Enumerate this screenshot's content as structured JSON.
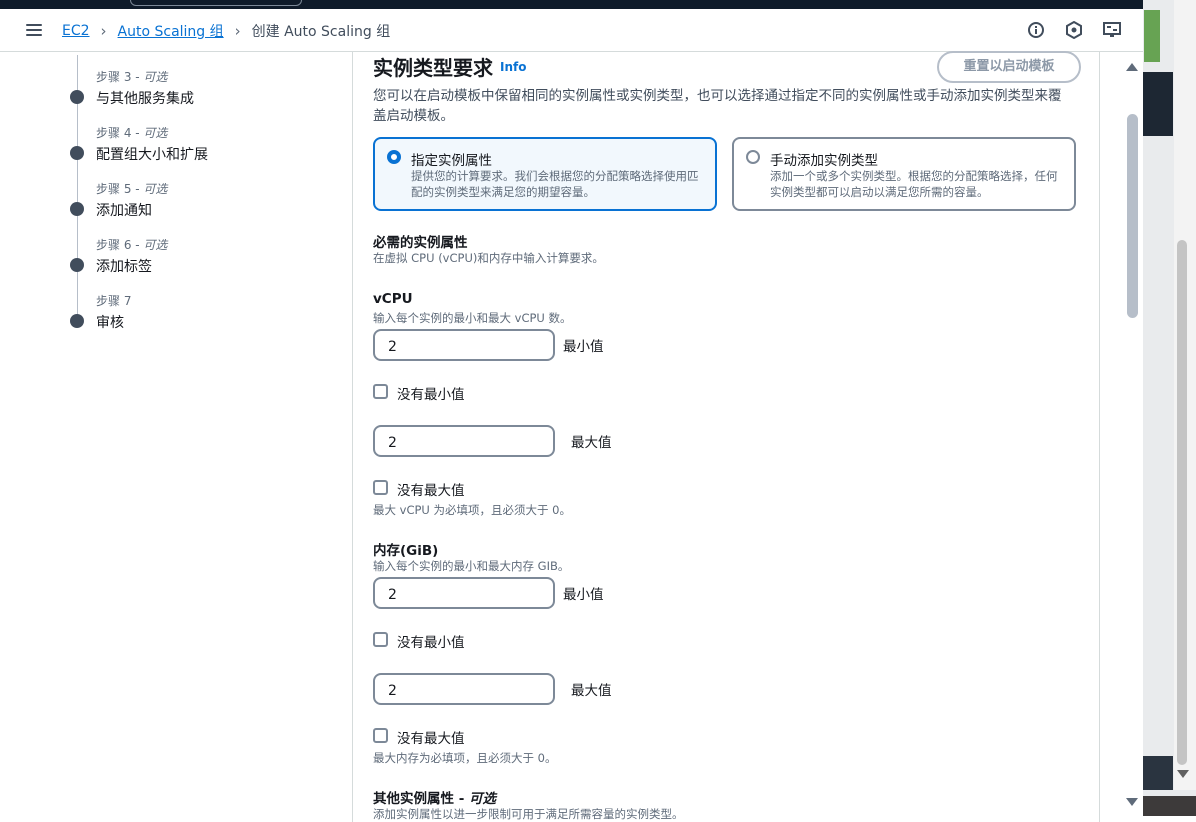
{
  "breadcrumb": {
    "items": [
      "EC2",
      "Auto Scaling 组"
    ],
    "current": "创建 Auto Scaling 组"
  },
  "header_icons": [
    "info-circle-icon",
    "notifications-icon",
    "settings-icon"
  ],
  "steps": [
    {
      "label": "步骤 3",
      "optional": "可选",
      "name": "与其他服务集成"
    },
    {
      "label": "步骤 4",
      "optional": "可选",
      "name": "配置组大小和扩展"
    },
    {
      "label": "步骤 5",
      "optional": "可选",
      "name": "添加通知"
    },
    {
      "label": "步骤 6",
      "optional": "可选",
      "name": "添加标签"
    },
    {
      "label": "步骤 7",
      "optional": "",
      "name": "审核"
    }
  ],
  "section": {
    "title": "实例类型要求",
    "info_link": "Info",
    "reset_button": "重置以启动模板",
    "description": "您可以在启动模板中保留相同的实例属性或实例类型，也可以选择通过指定不同的实例属性或手动添加实例类型来覆盖启动模板。"
  },
  "tiles": [
    {
      "title": "指定实例属性",
      "desc": "提供您的计算要求。我们会根据您的分配策略选择使用匹配的实例类型来满足您的期望容量。",
      "selected": true
    },
    {
      "title": "手动添加实例类型",
      "desc": "添加一个或多个实例类型。根据您的分配策略选择，任何实例类型都可以启动以满足您所需的容量。",
      "selected": false
    }
  ],
  "required": {
    "title": "必需的实例属性",
    "desc": "在虚拟 CPU (vCPU)和内存中输入计算要求。"
  },
  "vcpu": {
    "title": "vCPU",
    "desc": "输入每个实例的最小和最大 vCPU 数。",
    "min_value": "2",
    "min_label": "最小值",
    "no_min": "没有最小值",
    "max_value": "2",
    "max_label": "最大值",
    "no_max": "没有最大值",
    "hint": "最大 vCPU 为必填项，且必须大于 0。"
  },
  "memory": {
    "title": "内存(GiB)",
    "desc": "输入每个实例的最小和最大内存 GIB。",
    "min_value": "2",
    "min_label": "最小值",
    "no_min": "没有最小值",
    "max_value": "2",
    "max_label": "最大值",
    "no_max": "没有最大值",
    "hint": "最大内存为必填项，且必须大于 0。"
  },
  "optional_attrs": {
    "title": "其他实例属性 - ",
    "title_optional": "可选",
    "desc": "添加实例属性以进一步限制可用于满足所需容量的实例类型。"
  }
}
